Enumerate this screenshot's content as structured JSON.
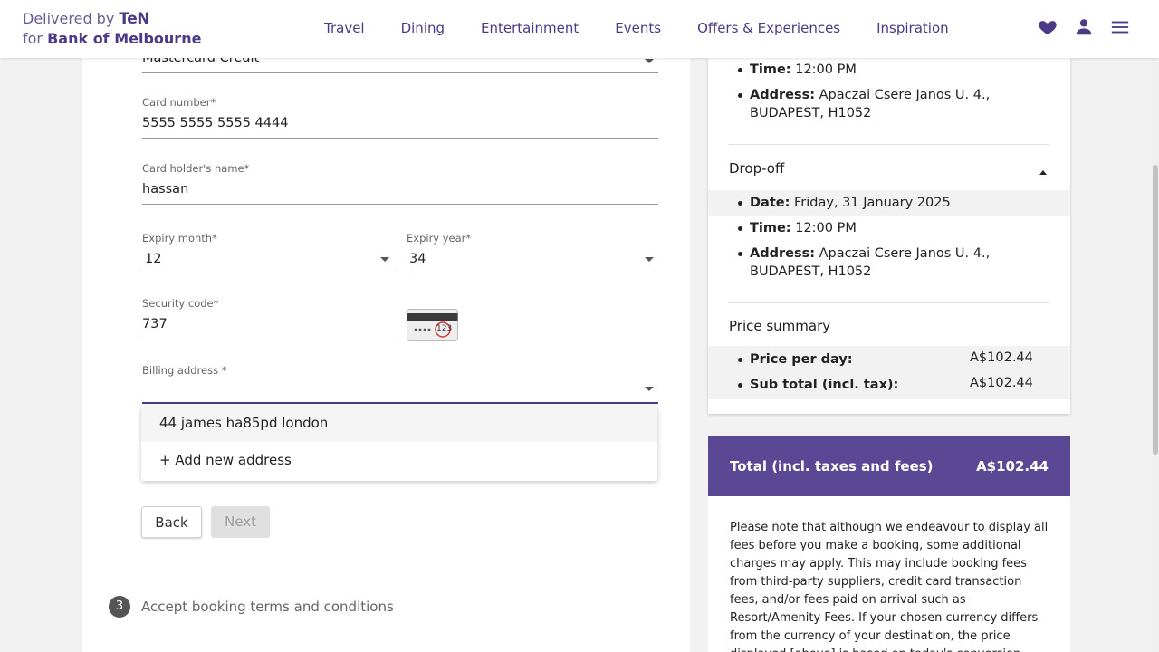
{
  "header": {
    "brand_line1": "Delivered by",
    "brand_ten": "TeN",
    "brand_line2_prefix": "for",
    "brand_bank": "Bank of Melbourne",
    "nav": [
      "Travel",
      "Dining",
      "Entertainment",
      "Events",
      "Offers & Experiences",
      "Inspiration"
    ],
    "icons": [
      "heart-icon",
      "user-icon",
      "menu-icon"
    ],
    "accent": "#4c3a86"
  },
  "form": {
    "card_type_value": "Mastercard Credit",
    "card_number_label": "Card number*",
    "card_number_value": "5555 5555 5555 4444",
    "holder_label": "Card holder's name*",
    "holder_value": "hassan",
    "expiry_month_label": "Expiry month*",
    "expiry_month_value": "12",
    "expiry_year_label": "Expiry year*",
    "expiry_year_value": "34",
    "security_label": "Security code*",
    "security_value": "737",
    "cvv_hint": "123",
    "billing_label": "Billing address *",
    "billing_options": [
      "44 james ha85pd london",
      "+ Add new address"
    ],
    "back_label": "Back",
    "next_label": "Next"
  },
  "step3": {
    "number": "3",
    "label": "Accept booking terms and conditions"
  },
  "summary": {
    "pickup_time_label": "Time:",
    "pickup_time": "12:00 PM",
    "pickup_address_label": "Address:",
    "pickup_address_line1": "Apaczai Csere Janos U. 4.,",
    "pickup_address_line2": "BUDAPEST, H1052",
    "dropoff_title": "Drop-off",
    "dropoff_date_label": "Date:",
    "dropoff_date": "Friday, 31 January 2025",
    "dropoff_time_label": "Time:",
    "dropoff_time": "12:00 PM",
    "dropoff_address_label": "Address:",
    "dropoff_address_line1": "Apaczai Csere Janos U. 4.,",
    "dropoff_address_line2": "BUDAPEST, H1052",
    "price_title": "Price summary",
    "price_per_day_label": "Price per day:",
    "price_per_day": "A$102.44",
    "subtotal_label": "Sub total (incl. tax):",
    "subtotal": "A$102.44",
    "total_label": "Total (incl. taxes and fees)",
    "total_value": "A$102.44",
    "total_bg": "#5a4895",
    "note": "Please note that although we endeavour to display all fees before you make a booking, some additional charges may apply. This may include booking fees from third-party suppliers, credit card transaction fees, and/or fees paid on arrival such as Resort/Amenity Fees. If your chosen currency differs from the currency of your destination, the price displayed [above] is based on today's conversion rate. If you wish to transact in the currency of the destination, please"
  }
}
